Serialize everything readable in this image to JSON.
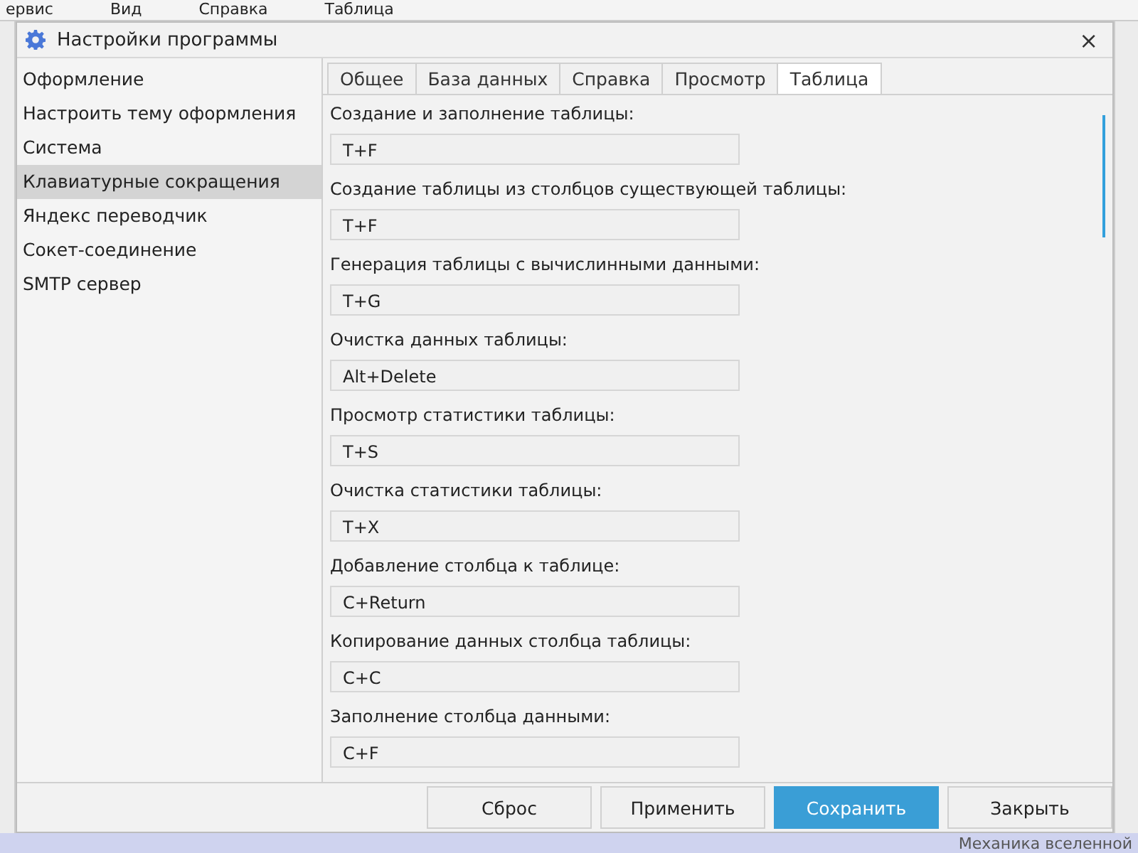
{
  "background_menu": [
    {
      "label": "ервис"
    },
    {
      "label": "Вид"
    },
    {
      "label": "Справка"
    },
    {
      "label": "Таблица"
    }
  ],
  "window": {
    "title": "Настройки программы",
    "close": "×"
  },
  "sidebar": {
    "items": [
      {
        "label": "Оформление",
        "selected": false
      },
      {
        "label": "Настроить тему оформления",
        "selected": false
      },
      {
        "label": "Система",
        "selected": false
      },
      {
        "label": "Клавиатурные сокращения",
        "selected": true
      },
      {
        "label": "Яндекс переводчик",
        "selected": false
      },
      {
        "label": "Сокет-соединение",
        "selected": false
      },
      {
        "label": "SMTP сервер",
        "selected": false
      }
    ]
  },
  "tabs": [
    {
      "label": "Общее",
      "selected": false
    },
    {
      "label": "База данных",
      "selected": false
    },
    {
      "label": "Справка",
      "selected": false
    },
    {
      "label": "Просмотр",
      "selected": false
    },
    {
      "label": "Таблица",
      "selected": true
    }
  ],
  "shortcuts": [
    {
      "label": "Создание и заполнение таблицы:",
      "value": "T+F"
    },
    {
      "label": "Создание таблицы из столбцов существующей таблицы:",
      "value": "T+F"
    },
    {
      "label": "Генерация таблицы с вычислинными данными:",
      "value": "T+G"
    },
    {
      "label": "Очистка данных таблицы:",
      "value": "Alt+Delete"
    },
    {
      "label": "Просмотр статистики таблицы:",
      "value": "T+S"
    },
    {
      "label": "Очистка статистики таблицы:",
      "value": "T+X"
    },
    {
      "label": "Добавление столбца к таблице:",
      "value": "C+Return"
    },
    {
      "label": "Копирование данных столбца таблицы:",
      "value": "C+C"
    },
    {
      "label": "Заполнение столбца данными:",
      "value": "C+F"
    }
  ],
  "buttons": [
    {
      "label": "Сброс",
      "kind": "normal"
    },
    {
      "label": "Применить",
      "kind": "normal"
    },
    {
      "label": "Сохранить",
      "kind": "primary"
    },
    {
      "label": "Закрыть",
      "kind": "normal"
    }
  ],
  "background_status": {
    "text": "Механика вселенной"
  }
}
